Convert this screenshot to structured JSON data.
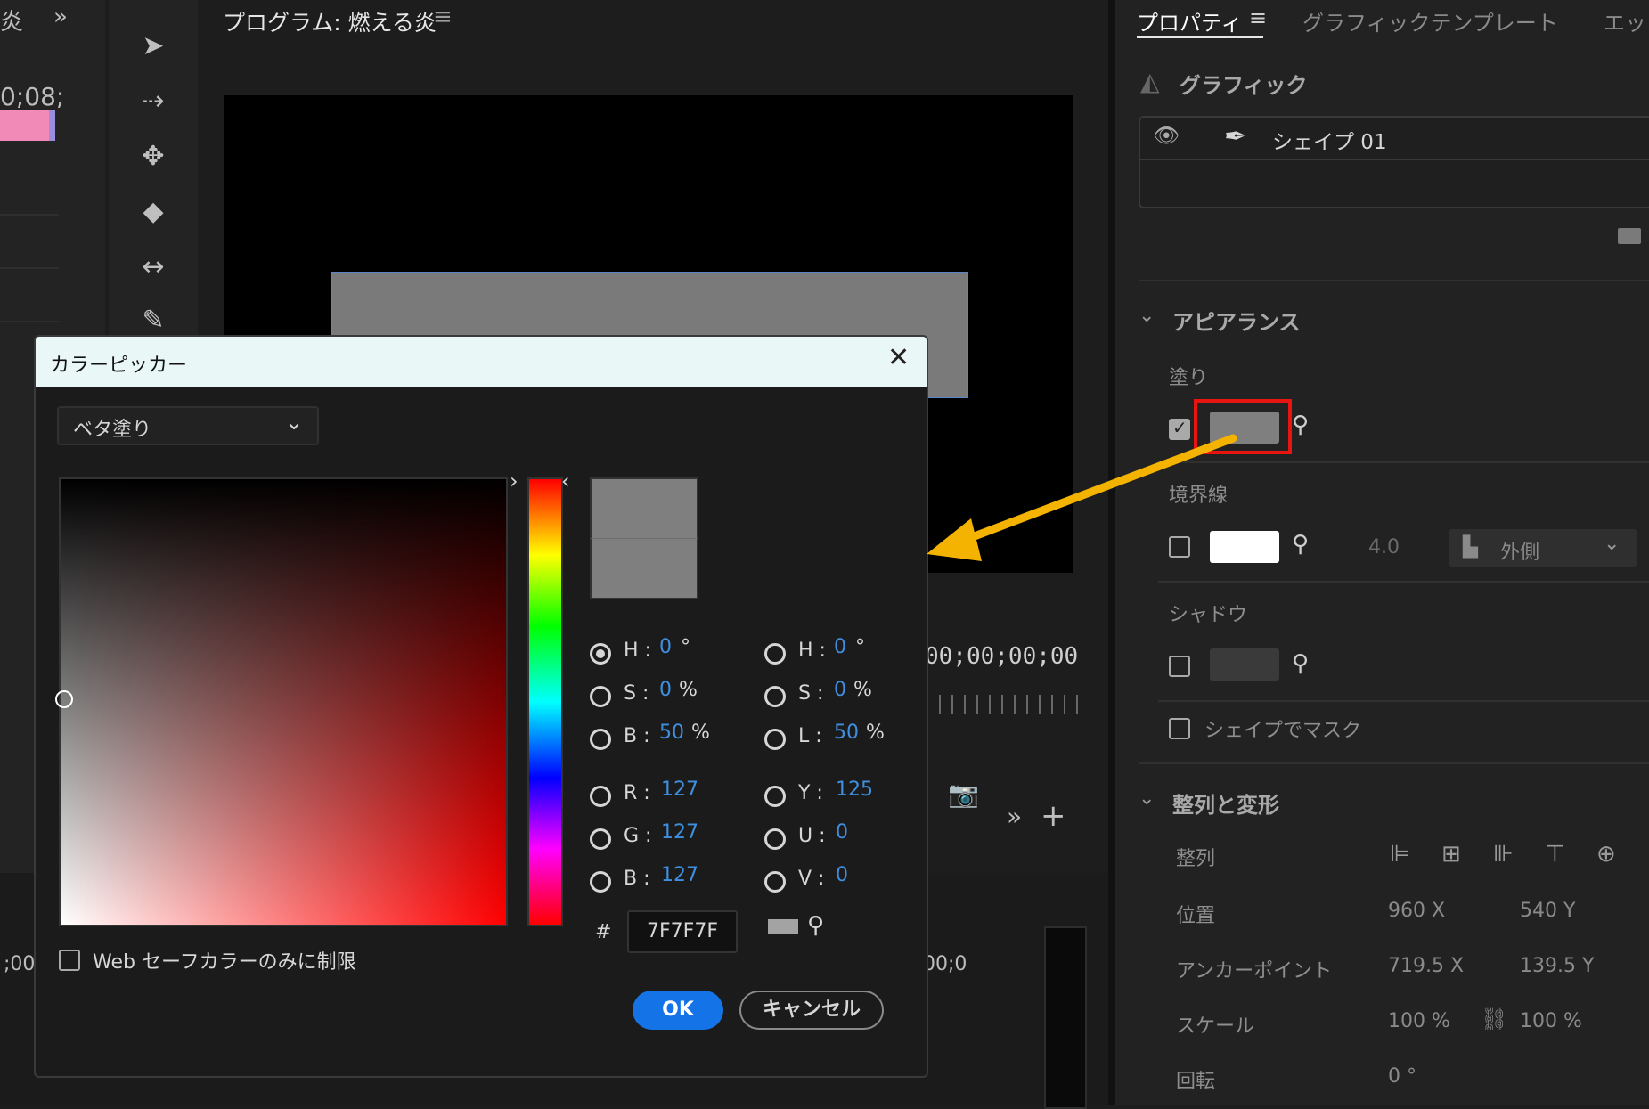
{
  "left_strip": {
    "top_text": "炎",
    "menu": "»",
    "timecode": "0;08;",
    "bottom_tc": ";00"
  },
  "program": {
    "title": "プログラム: 燃える炎",
    "menu_icon": "≡",
    "timecode_right": "00;00;00;00",
    "timecode_small": "00;0"
  },
  "properties": {
    "tabs": [
      "プロパティ",
      "グラフィックテンプレート",
      "エッ"
    ],
    "menu_icon": "≡",
    "graphic_label": "グラフィック",
    "layer_name": "シェイプ 01",
    "appearance": {
      "title": "アピアランス",
      "fill_label": "塗り",
      "fill_color": "#7f7f7f",
      "stroke_label": "境界線",
      "stroke_color": "#ffffff",
      "stroke_width": "4.0",
      "stroke_position": "外側",
      "shadow_label": "シャドウ",
      "mask_label": "シェイプでマスク"
    },
    "align": {
      "title": "整列と変形",
      "align_label": "整列",
      "position_label": "位置",
      "position_x": "960 X",
      "position_y": "540 Y",
      "anchor_label": "アンカーポイント",
      "anchor_x": "719.5 X",
      "anchor_y": "139.5 Y",
      "scale_label": "スケール",
      "scale_x": "100 %",
      "scale_y": "100 %",
      "rotation_label": "回転",
      "rotation": "0 °"
    }
  },
  "color_picker": {
    "title": "カラーピッカー",
    "fill_type": "ベタ塗り",
    "hsb": {
      "h_label": "H :",
      "h": "0",
      "h_unit": "°",
      "s_label": "S :",
      "s": "0",
      "s_unit": "%",
      "b_label": "B :",
      "b": "50",
      "b_unit": "%"
    },
    "hsl": {
      "h_label": "H :",
      "h": "0",
      "h_unit": "°",
      "s_label": "S :",
      "s": "0",
      "s_unit": "%",
      "l_label": "L :",
      "l": "50",
      "l_unit": "%"
    },
    "rgb": {
      "r_label": "R :",
      "r": "127",
      "g_label": "G :",
      "g": "127",
      "b_label": "B :",
      "b": "127"
    },
    "yuv": {
      "y_label": "Y :",
      "y": "125",
      "u_label": "U :",
      "u": "0",
      "v_label": "V :",
      "v": "0"
    },
    "hash": "#",
    "hex": "7F7F7F",
    "web_safe_label": "Web セーフカラーのみに制限",
    "ok": "OK",
    "cancel": "キャンセル",
    "current_color": "#7f7f7f"
  },
  "annotation": {
    "arrow_color": "#f5b301",
    "highlight_color": "#e8140f"
  }
}
